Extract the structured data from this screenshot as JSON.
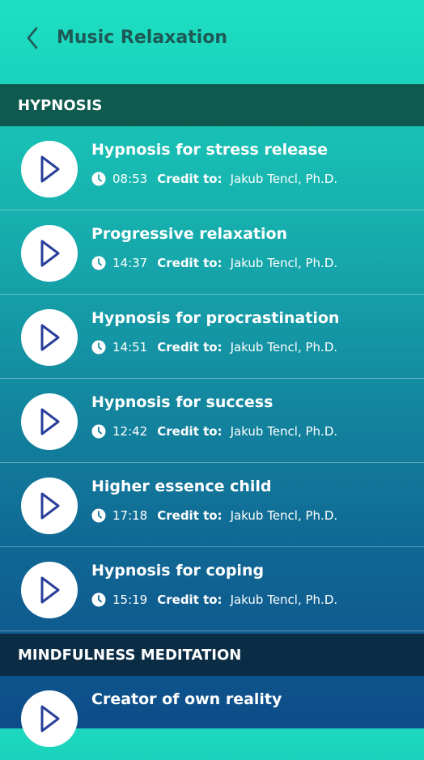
{
  "header": {
    "title": "Music Relaxation"
  },
  "sections": [
    {
      "label": "HYPNOSIS",
      "items": [
        {
          "title": "Hypnosis for stress release",
          "duration": "08:53",
          "credit_label": "Credit to:",
          "credit_name": "Jakub Tencl, Ph.D."
        },
        {
          "title": "Progressive relaxation",
          "duration": "14:37",
          "credit_label": "Credit to:",
          "credit_name": "Jakub Tencl, Ph.D."
        },
        {
          "title": "Hypnosis for procrastination",
          "duration": "14:51",
          "credit_label": "Credit to:",
          "credit_name": "Jakub Tencl, Ph.D."
        },
        {
          "title": "Hypnosis for success",
          "duration": "12:42",
          "credit_label": "Credit to:",
          "credit_name": "Jakub Tencl, Ph.D."
        },
        {
          "title": "Higher essence child",
          "duration": "17:18",
          "credit_label": "Credit to:",
          "credit_name": "Jakub Tencl, Ph.D."
        },
        {
          "title": "Hypnosis for coping",
          "duration": "15:19",
          "credit_label": "Credit to:",
          "credit_name": "Jakub Tencl, Ph.D."
        }
      ]
    },
    {
      "label": "MINDFULNESS MEDITATION",
      "items": [
        {
          "title": "Creator of own reality"
        }
      ]
    }
  ],
  "colors": {
    "header_bg": "#1edfc2",
    "section_hypnosis_bg": "#0f5a4f",
    "section_mindfulness_bg": "#0b2c45",
    "play_icon": "#2a3f9a"
  },
  "icons": {
    "back": "chevron-left-icon",
    "play": "play-icon",
    "duration": "clock-icon"
  }
}
